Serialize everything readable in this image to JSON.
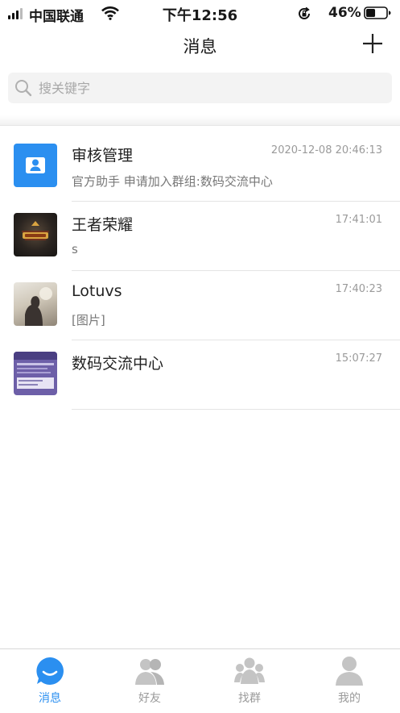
{
  "status_bar": {
    "carrier": "中国联通",
    "time": "下午12:56",
    "battery": "46%",
    "battery_level": 0.46
  },
  "navbar": {
    "title": "消息"
  },
  "search": {
    "placeholder": "搜关键字"
  },
  "conversations": [
    {
      "name": "审核管理",
      "time": "2020-12-08 20:46:13",
      "preview": "官方助手 申请加入群组:数码交流中心",
      "avatar": "person-icon"
    },
    {
      "name": "王者荣耀",
      "time": "17:41:01",
      "preview": "s",
      "avatar": "game-avatar"
    },
    {
      "name": "Lotuvs",
      "time": "17:40:23",
      "preview": "[图片]",
      "avatar": "photo-avatar"
    },
    {
      "name": "数码交流中心",
      "time": "15:07:27",
      "preview": "",
      "avatar": "group-avatar"
    }
  ],
  "tabs": [
    {
      "label": "消息",
      "icon": "chat-bubble-icon",
      "active": true
    },
    {
      "label": "好友",
      "icon": "friends-icon",
      "active": false
    },
    {
      "label": "找群",
      "icon": "group-search-icon",
      "active": false
    },
    {
      "label": "我的",
      "icon": "profile-icon",
      "active": false
    }
  ],
  "colors": {
    "accent": "#2b8ff0",
    "inactive": "#9a9a9a",
    "inactive_icon": "#c4c4c4"
  }
}
